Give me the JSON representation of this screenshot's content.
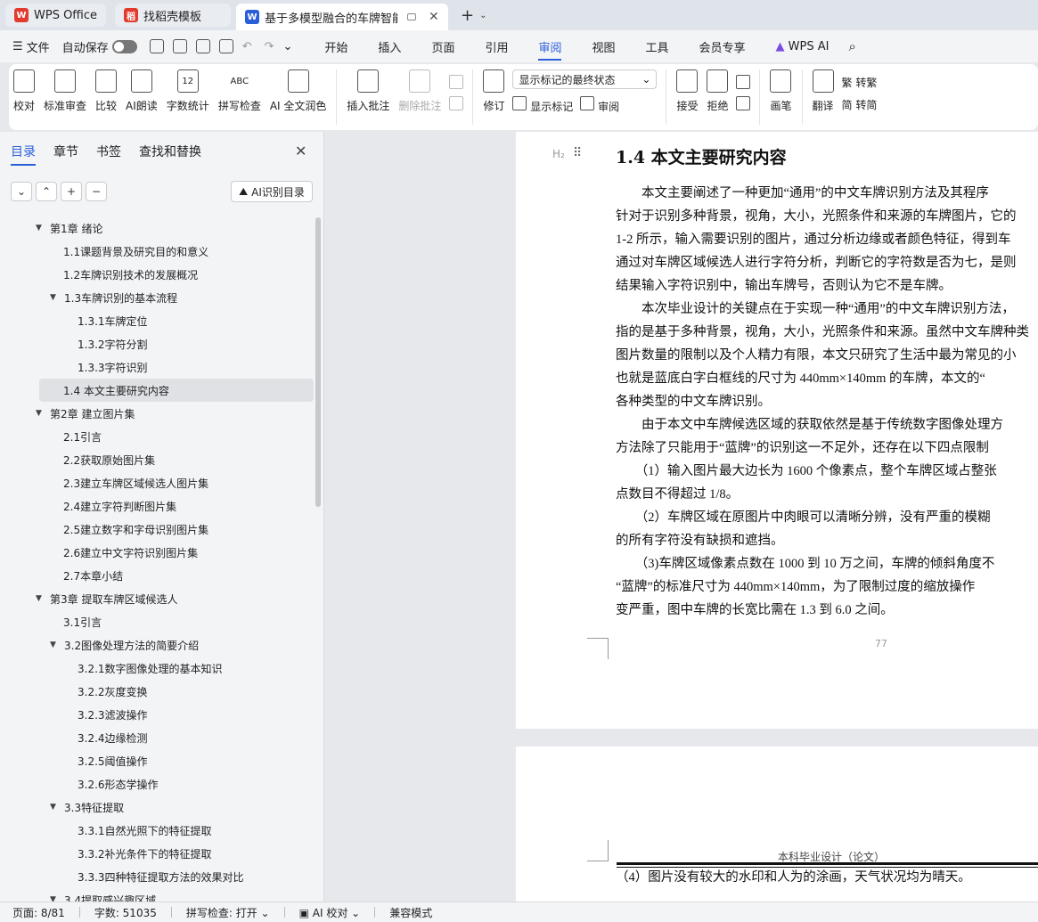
{
  "titlebar": {
    "tabs": [
      {
        "label": "WPS Office",
        "logo": "W",
        "color": "#e23b2e"
      },
      {
        "label": "找稻壳模板",
        "logo": "稻",
        "color": "#e23b2e"
      },
      {
        "label": "基于多模型融合的车牌智能识",
        "logo": "W",
        "color": "#2b5fd9"
      }
    ],
    "new_tab": "+",
    "dropdown": "⌄"
  },
  "menubar": {
    "file": "文件",
    "autosave": "自动保存",
    "tabs": [
      "开始",
      "插入",
      "页面",
      "引用",
      "审阅",
      "视图",
      "工具",
      "会员专享"
    ],
    "active_tab": "审阅",
    "wps_ai": "WPS AI"
  },
  "ribbon": {
    "buttons": [
      "校对",
      "标准审查",
      "比较",
      "AI朗读",
      "字数统计",
      "拼写检查",
      "AI 全文润色"
    ],
    "comment": [
      "插入批注",
      "删除批注"
    ],
    "revise": "修订",
    "markup_select": "显示标记的最终状态",
    "show_markup": "显示标记",
    "review": "审阅",
    "accept": "接受",
    "reject": "拒绝",
    "draw": "画笔",
    "translate": "翻译",
    "to_traditional": "转繁",
    "to_simplified": "转简",
    "word_count_icon_text": "12",
    "abc": "ABC"
  },
  "sidebar": {
    "tabs": [
      "目录",
      "章节",
      "书签",
      "查找和替换"
    ],
    "ai_button": "AI识别目录",
    "toc": [
      {
        "label": "第1章 绪论",
        "level": 1,
        "arrow": "▼"
      },
      {
        "label": "1.1课题背景及研究目的和意义",
        "level": 2
      },
      {
        "label": "1.2车牌识别技术的发展概况",
        "level": 2
      },
      {
        "label": "1.3车牌识别的基本流程",
        "level": 2,
        "arrow": "▼"
      },
      {
        "label": "1.3.1车牌定位",
        "level": 3
      },
      {
        "label": "1.3.2字符分割",
        "level": 3
      },
      {
        "label": "1.3.3字符识别",
        "level": 3
      },
      {
        "label": "1.4 本文主要研究内容",
        "level": 2,
        "active": true
      },
      {
        "label": "第2章 建立图片集",
        "level": 1,
        "arrow": "▼"
      },
      {
        "label": "2.1引言",
        "level": 2
      },
      {
        "label": "2.2获取原始图片集",
        "level": 2
      },
      {
        "label": "2.3建立车牌区域候选人图片集",
        "level": 2
      },
      {
        "label": "2.4建立字符判断图片集",
        "level": 2
      },
      {
        "label": "2.5建立数字和字母识别图片集",
        "level": 2
      },
      {
        "label": "2.6建立中文字符识别图片集",
        "level": 2
      },
      {
        "label": "2.7本章小结",
        "level": 2
      },
      {
        "label": "第3章 提取车牌区域候选人",
        "level": 1,
        "arrow": "▼"
      },
      {
        "label": "3.1引言",
        "level": 2
      },
      {
        "label": "3.2图像处理方法的简要介绍",
        "level": 2,
        "arrow": "▼"
      },
      {
        "label": "3.2.1数字图像处理的基本知识",
        "level": 3
      },
      {
        "label": "3.2.2灰度变换",
        "level": 3
      },
      {
        "label": "3.2.3滤波操作",
        "level": 3
      },
      {
        "label": "3.2.4边缘检测",
        "level": 3
      },
      {
        "label": "3.2.5阈值操作",
        "level": 3
      },
      {
        "label": "3.2.6形态学操作",
        "level": 3
      },
      {
        "label": "3.3特征提取",
        "level": 2,
        "arrow": "▼"
      },
      {
        "label": "3.3.1自然光照下的特征提取",
        "level": 3
      },
      {
        "label": "3.3.2补光条件下的特征提取",
        "level": 3
      },
      {
        "label": "3.3.3四种特征提取方法的效果对比",
        "level": 3
      },
      {
        "label": "3.4提取感兴趣区域",
        "level": 2,
        "arrow": "▼"
      }
    ]
  },
  "document": {
    "heading_mark": "H₂",
    "heading": "1.4 本文主要研究内容",
    "lines": [
      "　　本文主要阐述了一种更加“通用”的中文车牌识别方法及其程序",
      "针对于识别多种背景，视角，大小，光照条件和来源的车牌图片，它的",
      "1-2 所示，输入需要识别的图片，通过分析边缘或者颜色特征，得到车",
      "通过对车牌区域候选人进行字符分析，判断它的字符数是否为七，是则",
      "结果输入字符识别中，输出车牌号，否则认为它不是车牌。",
      "　　本次毕业设计的关键点在于实现一种“通用”的中文车牌识别方法，",
      "指的是基于多种背景，视角，大小，光照条件和来源。虽然中文车牌种类",
      "图片数量的限制以及个人精力有限，本文只研究了生活中最为常见的小",
      "也就是蓝底白字白框线的尺寸为  440mm×140mm 的车牌，本文的“",
      "各种类型的中文车牌识别。",
      "　　由于本文中车牌候选区域的获取依然是基于传统数字图像处理方",
      "方法除了只能用于“蓝牌”的识别这一不足外，还存在以下四点限制",
      "　　（1）输入图片最大边长为  1600 个像素点，整个车牌区域占整张",
      "点数目不得超过  1/8。",
      "　　（2）车牌区域在原图片中肉眼可以清晰分辨，没有严重的模糊",
      "的所有字符没有缺损和遮挡。",
      "　　（3)车牌区域像素点数在  1000 到 10 万之间，车牌的倾斜角度不",
      "“蓝牌”的标准尺寸为  440mm×140mm，为了限制过度的缩放操作",
      "变严重，图中车牌的长宽比需在  1.3 到 6.0 之间。"
    ],
    "page_number": "77",
    "page2_header": "本科毕业设计（论文）",
    "page2_line": "（4）图片没有较大的水印和人为的涂画，天气状况均为晴天。"
  },
  "statusbar": {
    "page": "页面: 8/81",
    "words": "字数: 51035",
    "spell": "拼写检查: 打开",
    "ai_check": "AI 校对",
    "compat": "兼容模式"
  }
}
